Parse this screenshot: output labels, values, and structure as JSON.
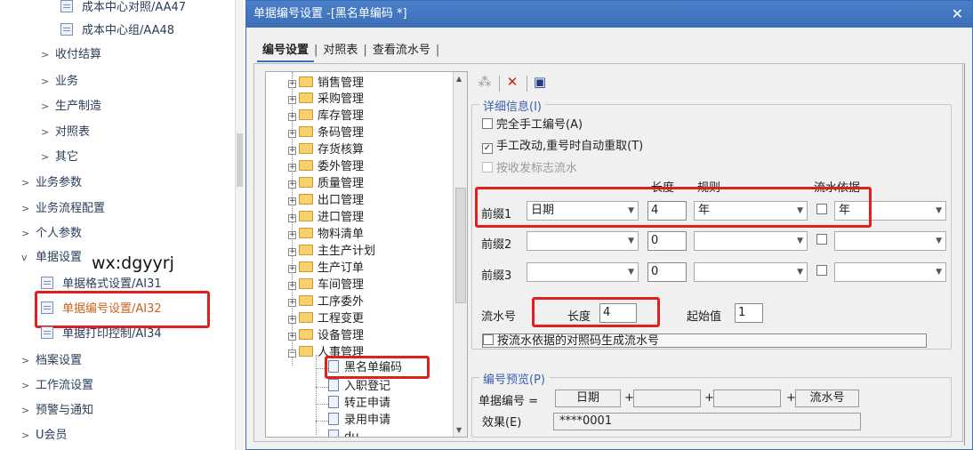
{
  "nav": {
    "items": [
      {
        "label": "成本中心对照/AA47",
        "type": "doc"
      },
      {
        "label": "成本中心组/AA48",
        "type": "doc"
      },
      {
        "label": "收付结算",
        "type": "group"
      },
      {
        "label": "业务",
        "type": "group"
      },
      {
        "label": "生产制造",
        "type": "group"
      },
      {
        "label": "对照表",
        "type": "group"
      },
      {
        "label": "其它",
        "type": "group"
      },
      {
        "label": "业务参数",
        "type": "group"
      },
      {
        "label": "业务流程配置",
        "type": "group"
      },
      {
        "label": "个人参数",
        "type": "group"
      },
      {
        "label": "单据设置",
        "type": "group-open"
      },
      {
        "label": "单据格式设置/AI31",
        "type": "doc"
      },
      {
        "label": "单据编号设置/AI32",
        "type": "doc",
        "highlighted": true
      },
      {
        "label": "单据打印控制/AI34",
        "type": "doc"
      },
      {
        "label": "档案设置",
        "type": "group"
      },
      {
        "label": "工作流设置",
        "type": "group"
      },
      {
        "label": "预警与通知",
        "type": "group"
      },
      {
        "label": "U会员",
        "type": "group"
      }
    ],
    "watermark": "wx:dgyyrj"
  },
  "dialog": {
    "title": "单据编号设置 -[黑名单编码 *]",
    "close_icon": "close-icon",
    "tabs": [
      "编号设置",
      "对照表",
      "查看流水号"
    ],
    "tree": {
      "folders": [
        "销售管理",
        "采购管理",
        "库存管理",
        "条码管理",
        "存货核算",
        "委外管理",
        "质量管理",
        "出口管理",
        "进口管理",
        "物料清单",
        "主生产计划",
        "生产订单",
        "车间管理",
        "工序委外",
        "工程变更",
        "设备管理",
        "人事管理"
      ],
      "docs": [
        "黑名单编码",
        "入职登记",
        "转正申请",
        "录用申请",
        "du…"
      ]
    },
    "toolbar": [
      "magic-wand-icon",
      "delete-icon",
      "save-icon"
    ],
    "detail": {
      "legend": "详细信息(I)",
      "opt_manual": "完全手工编号(A)",
      "opt_auto_renumber": "手工改动,重号时自动重取(T)",
      "opt_flag_serial": "按收发标志流水",
      "col_length": "长度",
      "col_rule": "规则",
      "col_serial_basis": "流水依据",
      "prefix1_label": "前缀1",
      "prefix1_value": "日期",
      "prefix1_length": "4",
      "prefix1_rule": "年",
      "prefix1_basis": "年",
      "prefix2_label": "前缀2",
      "prefix2_length": "0",
      "prefix3_label": "前缀3",
      "prefix3_length": "0",
      "serial_label": "流水号",
      "serial_length_label": "长度",
      "serial_length": "4",
      "start_label": "起始值",
      "start_value": "1",
      "opt_gen_by_basis": "按流水依据的对照码生成流水号"
    },
    "preview": {
      "legend": "编号预览(P)",
      "doc_no_label": "单据编号 =",
      "part1": "日期",
      "part4": "流水号",
      "effect_label": "效果(E)",
      "effect_value": "****0001"
    }
  }
}
